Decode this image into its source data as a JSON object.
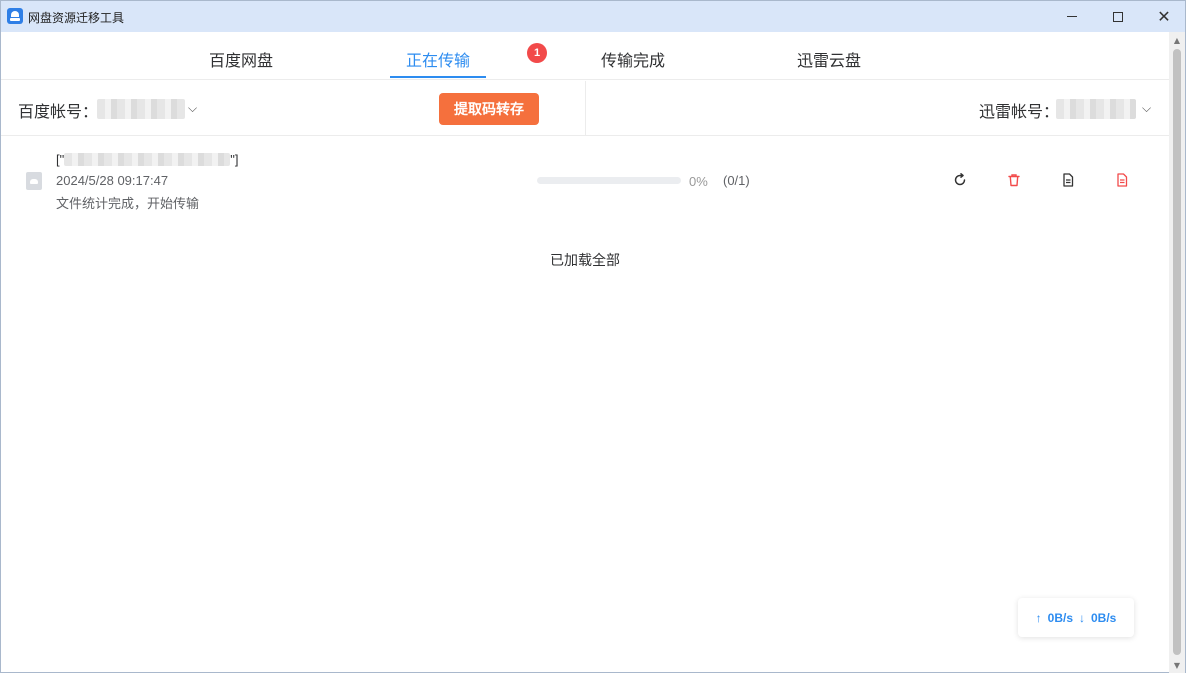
{
  "window": {
    "title": "网盘资源迁移工具"
  },
  "tabs": [
    {
      "label": "百度网盘",
      "active": false
    },
    {
      "label": "正在传输",
      "active": true,
      "badge": "1"
    },
    {
      "label": "传输完成",
      "active": false
    },
    {
      "label": "迅雷云盘",
      "active": false
    }
  ],
  "accounts": {
    "baidu_label": "百度帐号：",
    "xunlei_label": "迅雷帐号：",
    "transfer_button": "提取码转存"
  },
  "transfers": [
    {
      "name_prefix": "[\"",
      "name_suffix": "\"]",
      "time": "2024/5/28 09:17:47",
      "status": "文件统计完成，开始传输",
      "progress": 0,
      "progress_text": "0%",
      "count_text": "(0/1)"
    }
  ],
  "list_footer": "已加载全部",
  "speed": {
    "upload": "0B/s",
    "download": "0B/s"
  },
  "colors": {
    "accent": "#2d8cf0",
    "button": "#f5703d",
    "danger": "#f24a4a",
    "titlebar": "#d9e6f9"
  },
  "icons": [
    "app-icon",
    "minimize-icon",
    "maximize-icon",
    "close-icon",
    "chevron-down-icon",
    "cloud-file-icon",
    "retry-icon",
    "trash-icon",
    "document-icon",
    "error-log-icon",
    "arrow-up-icon",
    "arrow-down-icon"
  ]
}
